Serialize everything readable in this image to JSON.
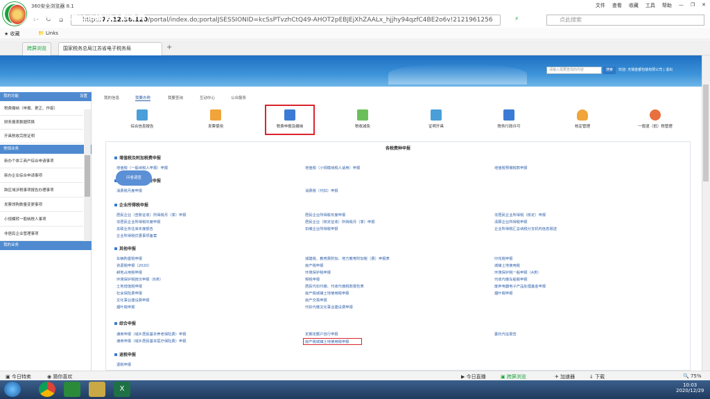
{
  "browser": {
    "title": "360安全浏览器 8.1",
    "menu": [
      "文件",
      "查看",
      "收藏",
      "工具",
      "帮助"
    ],
    "url_prefix": "http://",
    "url_host": "77.12.56.120",
    "url_path": "/portal/index.do;portalJSESSIONID=kcSsPTvzhCtQ49-AHOT2pEBJEjXhZAALx_hjjhy94qzfC4BE2o6v!2121961256",
    "search_placeholder": "点此搜索",
    "bookmarks": [
      "收藏",
      "Links"
    ],
    "tabs": [
      "跨屏浏览",
      "国家税务总局江苏省电子税务局"
    ]
  },
  "header": {
    "title": "国家税务总局江苏省电子税务局",
    "search_placeholder": "请输入需要查找的内容",
    "search_button": "搜索",
    "user_text": "欢迎: 无锡金都包装有限公司 | 退出"
  },
  "sidebar": {
    "head1": "我的功能",
    "head1_right": "设置",
    "items1": [
      "税费缴纳（申报、更正、作废）",
      "财务报表数据转换",
      "开具税收完税证明"
    ],
    "head2": "常规业务",
    "items2": [
      "新办个体工商户综合申请事项",
      "新办企业综合申请事项",
      "跨区域涉税事项报告办理事项",
      "发票领购数量变更事项",
      "小规模转一般纳税人事项",
      "非居民企业管理事项"
    ],
    "head3": "我的业务"
  },
  "content": {
    "tabs": [
      "我的信息",
      "我要办税",
      "我要查询",
      "互动中心",
      "公众服务"
    ],
    "functions": [
      "综合信息报告",
      "发票使用",
      "税费申报及缴纳",
      "税收减免",
      "证明开具",
      "税务行政许可",
      "核定管理",
      "一般退（抵）税管理"
    ],
    "panel_title": "各税费种申报",
    "sections": [
      {
        "title": "增值税及附加税费申报",
        "links": [
          "增值税（一般纳税人申报）申报",
          "增值税（小规模纳税人适用）申报",
          "增值税预缴税款申报"
        ]
      },
      {
        "title": "消费税及附加税费申报",
        "links": [
          "消费税月度申报",
          "消费税（代扣）申报"
        ]
      },
      {
        "title": "企业所得税申报",
        "links": [
          "居民企业（查账征收）所得税月（季）申报",
          "居民企业所得税年度申报",
          "非居民企业所得税（核定）申报",
          "非居民企业所得税年度申报",
          "居民企业（核定征收）所得税月（季）申报",
          "清算企业所得税申报",
          "关联业务往来年度报告",
          "扣缴企业所得税申报",
          "企业所得税汇总纳税分支机构信息报送",
          "企业所得税优惠事项备案"
        ]
      },
      {
        "title": "其他申报",
        "links": [
          "车辆购置税申报",
          "城建税、教育费附加、地方教育附加税（费）申报表",
          "印花税申报",
          "资源税申报（2020）",
          "房产税申报",
          "城镇土地使用税",
          "耕地占用税申报",
          "环境保护税申报",
          "环境保护税一般申报（A类）",
          "环境保护税按次申报（B类）",
          "契税申报",
          "代收代缴车船税申报",
          "土地增值税申报",
          "居民代扣代缴、代收代缴税款报告表",
          "废弃电器电子产品处理基金申报",
          "社会保险费申报",
          "房产税城镇土地使用税申报",
          "烟叶税申报",
          "文化事业建设费申报",
          "房产交易申报",
          "",
          "烟叶税申报",
          "代扣代缴文化事业建设费申报",
          ""
        ]
      },
      {
        "title": "综合申报",
        "links": [
          "通用申报（城乡居民基本养老保险费）申报",
          "定期定额户自行申报",
          "委托代征报告",
          "通用申报（城乡居民基本医疗保险费）申报",
          "房产税城镇土地使用税申报"
        ]
      },
      {
        "title": "退税申报",
        "links": [
          "退税申报"
        ]
      }
    ],
    "cloud_label": "问卷调查"
  },
  "statusbar": {
    "left": [
      "今日特卖",
      "猜你喜欢"
    ],
    "right": [
      "今日直播",
      "跨屏浏览",
      "加速器",
      "下载",
      "75%"
    ]
  },
  "taskbar": {
    "time": "10:03",
    "date": "2020/12/29"
  }
}
